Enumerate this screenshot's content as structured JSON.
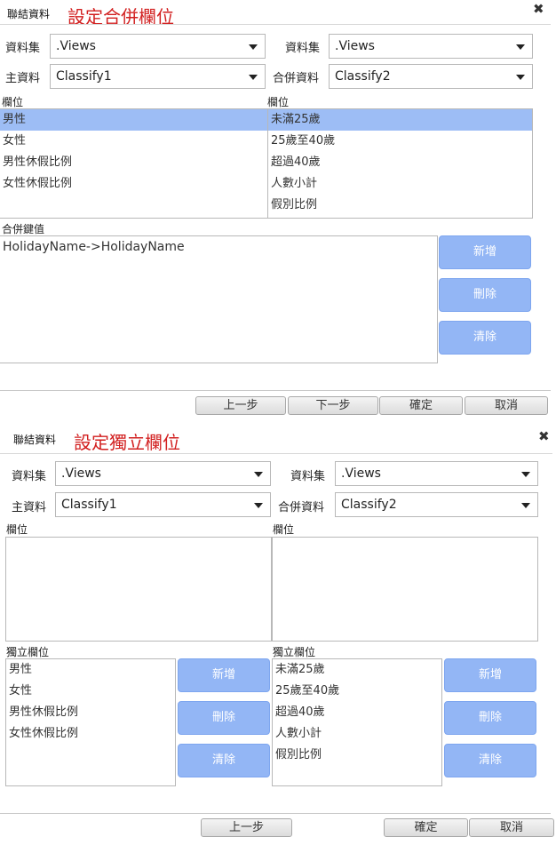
{
  "panel1": {
    "window_title": "聯結資料",
    "heading": "設定合併欄位",
    "dataset_label_left": "資料集",
    "dataset_value_left": ".Views",
    "dataset_label_right": "資料集",
    "dataset_value_right": ".Views",
    "master_label": "主資料",
    "master_value": "Classify1",
    "merge_label": "合併資料",
    "merge_value": "Classify2",
    "fields_label_left": "欄位",
    "fields_label_right": "欄位",
    "left_fields": [
      "男性",
      "女性",
      "男性休假比例",
      "女性休假比例"
    ],
    "right_fields": [
      "未滿25歲",
      "25歲至40歲",
      "超過40歲",
      "人數小計",
      "假別比例"
    ],
    "merge_keys_label": "合併鍵值",
    "merge_keys": [
      "HolidayName->HolidayName"
    ],
    "add_button": "新增",
    "delete_button": "刪除",
    "clear_button": "清除",
    "prev_button": "上一步",
    "next_button": "下一步",
    "ok_button": "確定",
    "cancel_button": "取消"
  },
  "panel2": {
    "window_title": "聯結資料",
    "heading": "設定獨立欄位",
    "dataset_label_left": "資料集",
    "dataset_value_left": ".Views",
    "dataset_label_right": "資料集",
    "dataset_value_right": ".Views",
    "master_label": "主資料",
    "master_value": "Classify1",
    "merge_label": "合併資料",
    "merge_value": "Classify2",
    "fields_label_left": "欄位",
    "fields_label_right": "欄位",
    "indep_label_left": "獨立欄位",
    "indep_label_right": "獨立欄位",
    "left_indep": [
      "男性",
      "女性",
      "男性休假比例",
      "女性休假比例"
    ],
    "right_indep": [
      "未滿25歲",
      "25歲至40歲",
      "超過40歲",
      "人數小計",
      "假別比例"
    ],
    "add_button": "新增",
    "delete_button": "刪除",
    "clear_button": "清除",
    "prev_button": "上一步",
    "ok_button": "確定",
    "cancel_button": "取消"
  },
  "icons": {
    "close": "close-icon",
    "dropdown": "chevron-down-icon"
  }
}
